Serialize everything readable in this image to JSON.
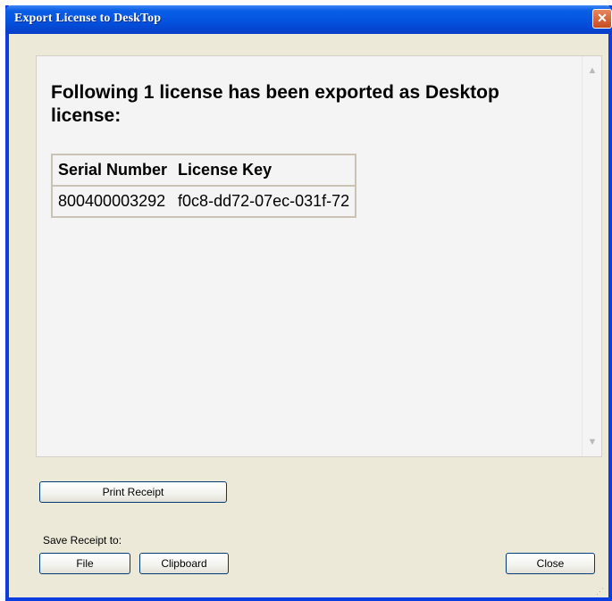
{
  "window": {
    "title": "Export License to DeskTop"
  },
  "content": {
    "heading": "Following 1 license has been exported as Desktop license:",
    "table": {
      "headers": [
        "Serial Number",
        "License Key"
      ],
      "rows": [
        [
          "800400003292",
          "f0c8-dd72-07ec-031f-72"
        ]
      ]
    }
  },
  "buttons": {
    "print": "Print Receipt",
    "file": "File",
    "clipboard": "Clipboard",
    "close": "Close"
  },
  "labels": {
    "save_receipt": "Save Receipt to:"
  },
  "icons": {
    "close": "close-x-icon",
    "scroll_up": "chevron-up-icon",
    "scroll_down": "chevron-down-icon",
    "resize_grip": "resize-grip-icon"
  },
  "colors": {
    "titlebar": "#0453df",
    "window_bg": "#ece9d8",
    "panel_bg": "#f4f4f4",
    "close_button": "#c64a20"
  }
}
